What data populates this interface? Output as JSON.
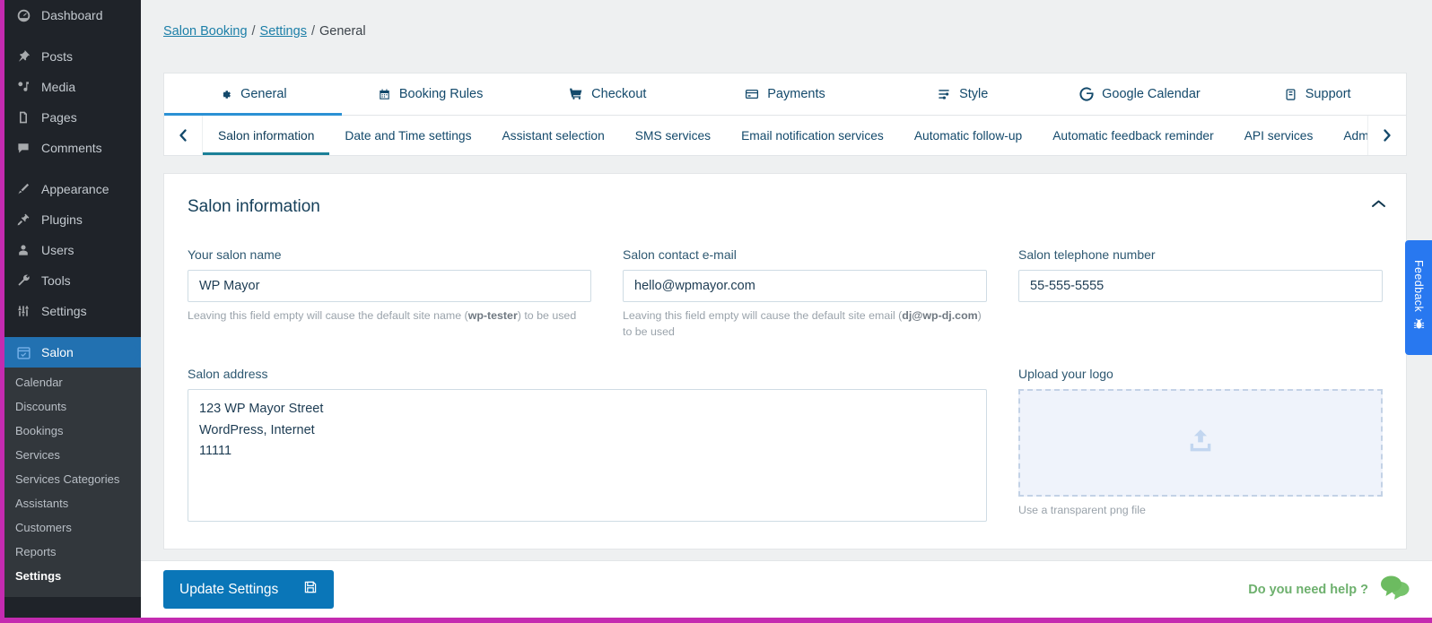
{
  "wp_sidebar": {
    "items": [
      {
        "label": "Dashboard",
        "icon": "dashboard-icon",
        "gap_after": true
      },
      {
        "label": "Posts",
        "icon": "pin-icon",
        "gap_after": false
      },
      {
        "label": "Media",
        "icon": "media-icon",
        "gap_after": false
      },
      {
        "label": "Pages",
        "icon": "pages-icon",
        "gap_after": false
      },
      {
        "label": "Comments",
        "icon": "comment-icon",
        "gap_after": true
      },
      {
        "label": "Appearance",
        "icon": "brush-icon",
        "gap_after": false
      },
      {
        "label": "Plugins",
        "icon": "plug-icon",
        "gap_after": false
      },
      {
        "label": "Users",
        "icon": "user-icon",
        "gap_after": false
      },
      {
        "label": "Tools",
        "icon": "wrench-icon",
        "gap_after": false
      },
      {
        "label": "Settings",
        "icon": "sliders-icon",
        "gap_after": true
      }
    ],
    "active_item": {
      "label": "Salon",
      "icon": "calendar-check-icon"
    },
    "submenu": [
      {
        "label": "Calendar",
        "current": false
      },
      {
        "label": "Discounts",
        "current": false
      },
      {
        "label": "Bookings",
        "current": false
      },
      {
        "label": "Services",
        "current": false
      },
      {
        "label": "Services Categories",
        "current": false
      },
      {
        "label": "Assistants",
        "current": false
      },
      {
        "label": "Customers",
        "current": false
      },
      {
        "label": "Reports",
        "current": false
      },
      {
        "label": "Settings",
        "current": true
      }
    ],
    "active_color": "#2271b1"
  },
  "breadcrumb": {
    "root": "Salon Booking",
    "parent": "Settings",
    "current": "General",
    "separator": "/"
  },
  "top_tabs": [
    {
      "label": "General",
      "icon": "gear-icon",
      "active": true
    },
    {
      "label": "Booking Rules",
      "icon": "calendar-icon",
      "active": false
    },
    {
      "label": "Checkout",
      "icon": "cart-icon",
      "active": false
    },
    {
      "label": "Payments",
      "icon": "credit-card-icon",
      "active": false
    },
    {
      "label": "Style",
      "icon": "sliders-icon",
      "active": false
    },
    {
      "label": "Google Calendar",
      "icon": "google-icon",
      "active": false
    },
    {
      "label": "Support",
      "icon": "book-icon",
      "active": false
    }
  ],
  "sub_tabs": {
    "prev_arrow": "‹",
    "next_arrow": "›",
    "items": [
      {
        "label": "Salon information",
        "active": true
      },
      {
        "label": "Date and Time settings",
        "active": false
      },
      {
        "label": "Assistant selection",
        "active": false
      },
      {
        "label": "SMS services",
        "active": false
      },
      {
        "label": "Email notification services",
        "active": false
      },
      {
        "label": "Automatic follow-up",
        "active": false
      },
      {
        "label": "Automatic feedback reminder",
        "active": false
      },
      {
        "label": "API services",
        "active": false
      },
      {
        "label": "Administration",
        "active": false
      }
    ]
  },
  "panel": {
    "title": "Salon information",
    "fields": {
      "salon_name": {
        "label": "Your salon name",
        "value": "WP Mayor",
        "help_prefix": "Leaving this field empty will cause the default site name (",
        "help_bold": "wp-tester",
        "help_suffix": ") to be used"
      },
      "contact_email": {
        "label": "Salon contact e-mail",
        "value": "hello@wpmayor.com",
        "help_prefix": "Leaving this field empty will cause the default site email (",
        "help_bold": "dj@wp-dj.com",
        "help_suffix": ") to be used"
      },
      "telephone": {
        "label": "Salon telephone number",
        "value": "55-555-5555"
      },
      "address": {
        "label": "Salon address",
        "value": "123 WP Mayor Street\nWordPress, Internet\n11111"
      },
      "logo": {
        "label": "Upload your logo",
        "icon": "upload-icon",
        "help": "Use a transparent png file"
      }
    }
  },
  "footer": {
    "update_label": "Update Settings",
    "save_icon": "floppy-disk-icon",
    "help_label": "Do you need help ?",
    "help_icon": "chat-bubbles-icon",
    "button_color": "#0a76b8",
    "help_color": "#6db06d"
  },
  "feedback": {
    "label": "Feedback",
    "icon": "bug-icon",
    "color": "#2878f0"
  }
}
